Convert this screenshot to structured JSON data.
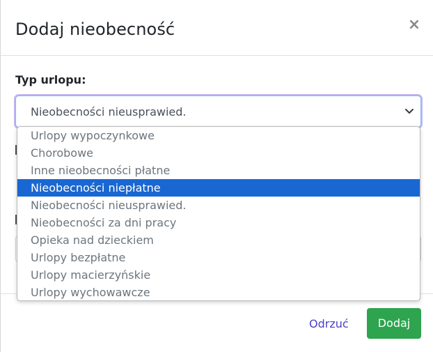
{
  "modal": {
    "title": "Dodaj nieobecność",
    "close_label": "×"
  },
  "leave_type": {
    "label": "Typ urlopu:",
    "selected_value": "Nieobecności nieusprawied.",
    "highlighted_option": "Nieobecności niepłatne",
    "options": [
      "Urlopy wypoczynkowe",
      "Chorobowe",
      "Inne nieobecności płatne",
      "Nieobecności niepłatne",
      "Nieobecności nieusprawied.",
      "Nieobecności za dni pracy",
      "Opieka nad dzieckiem",
      "Urlopy bezpłatne",
      "Urlopy macierzyńskie",
      "Urlopy wychowawcze"
    ]
  },
  "footer": {
    "cancel_label": "Odrzuć",
    "add_label": "Dodaj"
  },
  "colors": {
    "highlight": "#1967d2",
    "add_button": "#2ea44f",
    "cancel_link": "#4a3fc6"
  }
}
